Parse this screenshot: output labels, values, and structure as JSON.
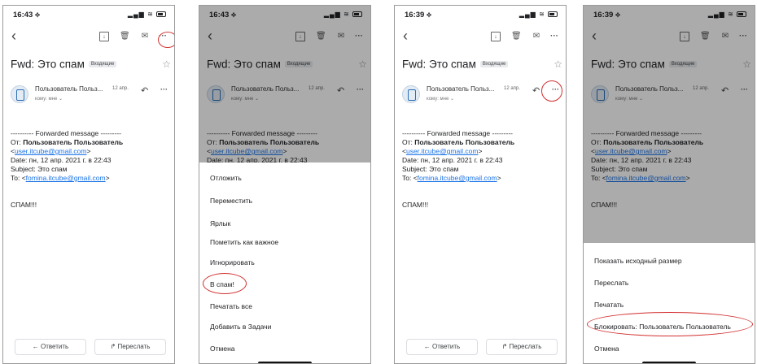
{
  "email": {
    "subject": "Fwd: Это спам",
    "label": "Входящие",
    "sender_short": "Пользователь Польз...",
    "date": "12 апр.",
    "to_line": "кому: мне ⌄",
    "forward_header": "---------- Forwarded message ---------",
    "from_prefix": "От: ",
    "from_name": "Пользователь Пользователь",
    "from_email": "user.itcube@gmail.com",
    "date_line": "Date: пн, 12 апр. 2021 г. в 22:43",
    "subject_line": "Subject: Это спам",
    "to_prefix": "To: ",
    "to_email": "fomina.itcube@gmail.com",
    "body_text": "СПАМ!!!"
  },
  "buttons": {
    "reply": "← Ответить",
    "forward": "↱ Переслать"
  },
  "screens": [
    {
      "time": "16:43 ⟡"
    },
    {
      "time": "16:43 ⟡",
      "menu": [
        "Отложить",
        "Переместить",
        "Ярлык",
        "Пометить как важное",
        "Игнорировать",
        "В спам!",
        "Печатать все",
        "Добавить в Задачи",
        "Отмена"
      ]
    },
    {
      "time": "16:39 ⟡"
    },
    {
      "time": "16:39 ⟡",
      "menu": [
        "Показать исходный размер",
        "Переслать",
        "Печатать",
        "Блокировать: Пользователь Пользователь",
        "Отмена"
      ]
    }
  ],
  "icons": {
    "back": "‹",
    "archive": "↓",
    "trash": "🗑",
    "mail": "✉",
    "more": "···",
    "star": "☆",
    "reply": "↶",
    "sender_more": "···",
    "signal": "▂▄▆",
    "wifi": "≋"
  },
  "colors": {
    "highlight": "#d32f2f",
    "link": "#1a73e8"
  }
}
